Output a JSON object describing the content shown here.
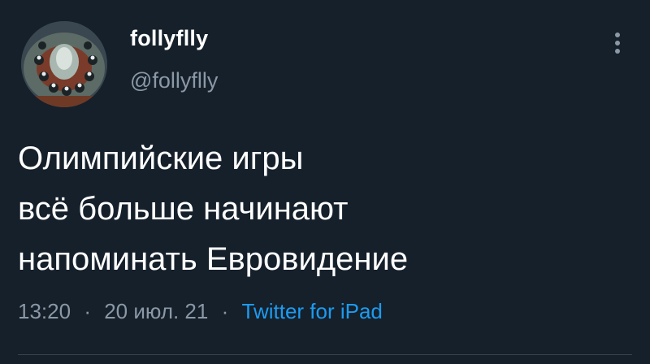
{
  "tweet": {
    "author": {
      "display_name": "follyflly",
      "handle": "@follyflly"
    },
    "text_lines": [
      "Олимпийские игры",
      "всё больше начинают",
      "напоминать Евровидение"
    ],
    "time": "13:20",
    "separator": "·",
    "date": "20 июл. 21",
    "source": "Twitter for iPad"
  },
  "colors": {
    "background": "#15202b",
    "primary_text": "#ffffff",
    "secondary_text": "#8b98a5",
    "link": "#1d9bf0"
  },
  "icons": {
    "more": "more-vertical-icon"
  }
}
